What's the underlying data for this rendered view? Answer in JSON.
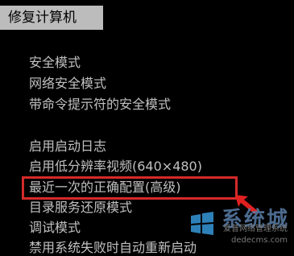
{
  "repair_button": "修复计算机",
  "menu": [
    {
      "label": "安全模式"
    },
    {
      "label": "网络安全模式"
    },
    {
      "label": "带命令提示符的安全模式"
    },
    {
      "label": "启用启动日志"
    },
    {
      "label": "启用低分辨率视频(640×480)"
    },
    {
      "label": "最近一次的正确配置(高级)"
    },
    {
      "label": "目录服务还原模式"
    },
    {
      "label": "调试模式"
    },
    {
      "label": "禁用系统失败时自动重新启动"
    }
  ],
  "watermark": {
    "brand": "系统城",
    "site_name": "爱普网络管理系统",
    "url": "dedecms.com"
  },
  "colors": {
    "background": "#000000",
    "text": "#c0c0c0",
    "highlight_border": "#d42a2a",
    "repair_bg": "#bcbcbc"
  }
}
